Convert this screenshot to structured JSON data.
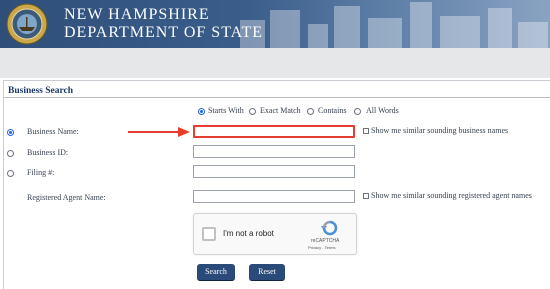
{
  "header": {
    "line1": "NEW HAMPSHIRE",
    "line2": "DEPARTMENT OF STATE"
  },
  "panel": {
    "title": "Business Search"
  },
  "search_modes": {
    "starts_with": "Starts With",
    "exact_match": "Exact Match",
    "contains": "Contains",
    "all_words": "All Words",
    "selected": "Starts With"
  },
  "fields": {
    "business_name": {
      "label": "Business Name:",
      "value": "",
      "checkbox_label": "Show me similar sounding business names"
    },
    "business_id": {
      "label": "Business ID:",
      "value": ""
    },
    "filing_no": {
      "label": "Filing #:",
      "value": ""
    },
    "agent_name": {
      "label": "Registered Agent Name:",
      "value": "",
      "checkbox_label": "Show me similar sounding registered agent names"
    }
  },
  "captcha": {
    "label": "I'm not a robot",
    "brand": "reCAPTCHA",
    "links": "Privacy - Terms"
  },
  "buttons": {
    "search": "Search",
    "reset": "Reset"
  },
  "colors": {
    "banner": "#2f4f7a",
    "accent": "#2a4a79",
    "highlight": "#e53e2e"
  }
}
